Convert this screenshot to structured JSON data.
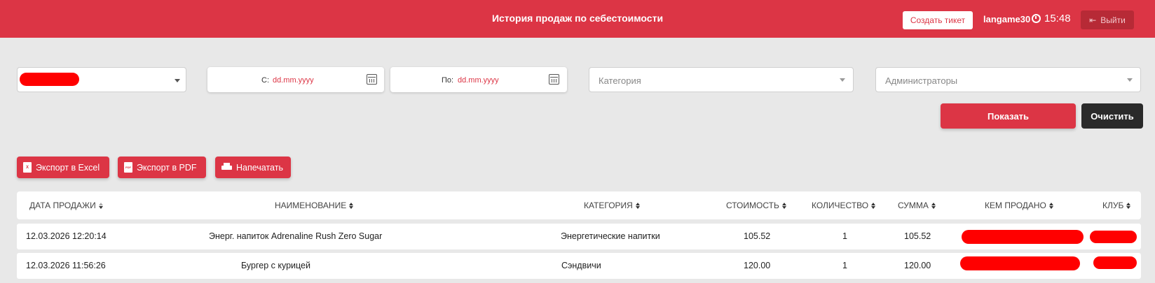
{
  "header": {
    "title": "История продаж по себестоимости",
    "create_ticket_label": "Создать тикет",
    "username": "langame30",
    "time": "15:48",
    "logout_label": "Выйти"
  },
  "filters": {
    "date_from_label": "С:",
    "date_from_value": "dd.mm.yyyy",
    "date_to_label": "По:",
    "date_to_value": "dd.mm.yyyy",
    "category_placeholder": "Категория",
    "administrators_placeholder": "Администраторы",
    "show_label": "Показать",
    "clear_label": "Очистить"
  },
  "export": {
    "excel_label": "Экспорт в Excel",
    "excel_icon_text": "X",
    "pdf_label": "Экспорт в PDF",
    "pdf_icon_text": "PDF",
    "print_label": "Напечатать"
  },
  "table": {
    "columns": [
      "ДАТА ПРОДАЖИ",
      "НАИМЕНОВАНИЕ",
      "КАТЕГОРИЯ",
      "СТОИМОСТЬ",
      "КОЛИЧЕСТВО",
      "СУММА",
      "КЕМ ПРОДАНО",
      "КЛУБ"
    ],
    "rows": [
      {
        "date": "12.03.2026 12:20:14",
        "name": "Энерг. напиток Adrenaline Rush Zero Sugar",
        "category": "Энергетические напитки",
        "cost": "105.52",
        "quantity": "1",
        "sum": "105.52"
      },
      {
        "date": "12.03.2026 11:56:26",
        "name": "Бургер с курицей",
        "category": "Сэндвичи",
        "cost": "120.00",
        "quantity": "1",
        "sum": "120.00"
      }
    ]
  },
  "colors": {
    "accent": "#dc3545",
    "dark_button": "#2a2a2a",
    "background": "#e8e8e8",
    "redaction": "#ff0000"
  }
}
